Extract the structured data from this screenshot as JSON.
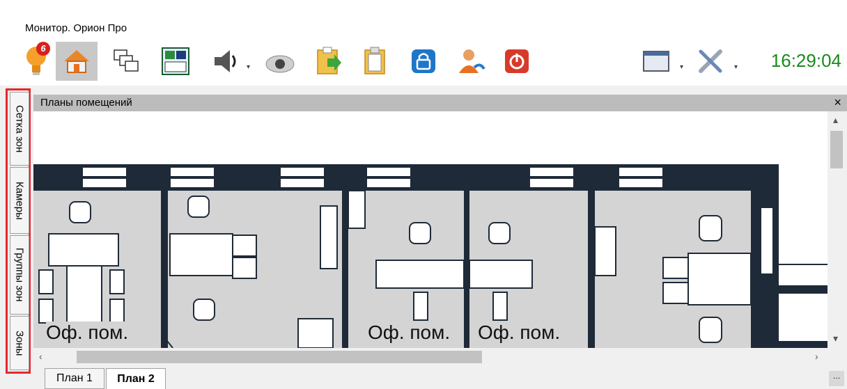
{
  "window": {
    "title": "Монитор. Орион Про"
  },
  "toolbar": {
    "alerts_badge": "6",
    "clock": "16:29:04",
    "buttons": [
      "lightbulb-alerts",
      "home",
      "windows",
      "plans",
      "sound",
      "camera",
      "export",
      "clipboard",
      "lock",
      "user-switch",
      "power",
      "window-layout",
      "settings"
    ]
  },
  "side_tabs": [
    "Сетка зон",
    "Камеры",
    "Группы зон",
    "Зоны"
  ],
  "panel": {
    "title": "Планы помещений",
    "close": "×"
  },
  "plan": {
    "rooms": [
      "Оф. пом.",
      "Оф. пом.",
      "Оф. пом."
    ]
  },
  "bottom_tabs": [
    "План 1",
    "План 2"
  ],
  "colors": {
    "clock": "#1a8a1a",
    "highlight": "#e8262b",
    "wall": "#1f2a38",
    "floor": "#d4d4d4"
  }
}
